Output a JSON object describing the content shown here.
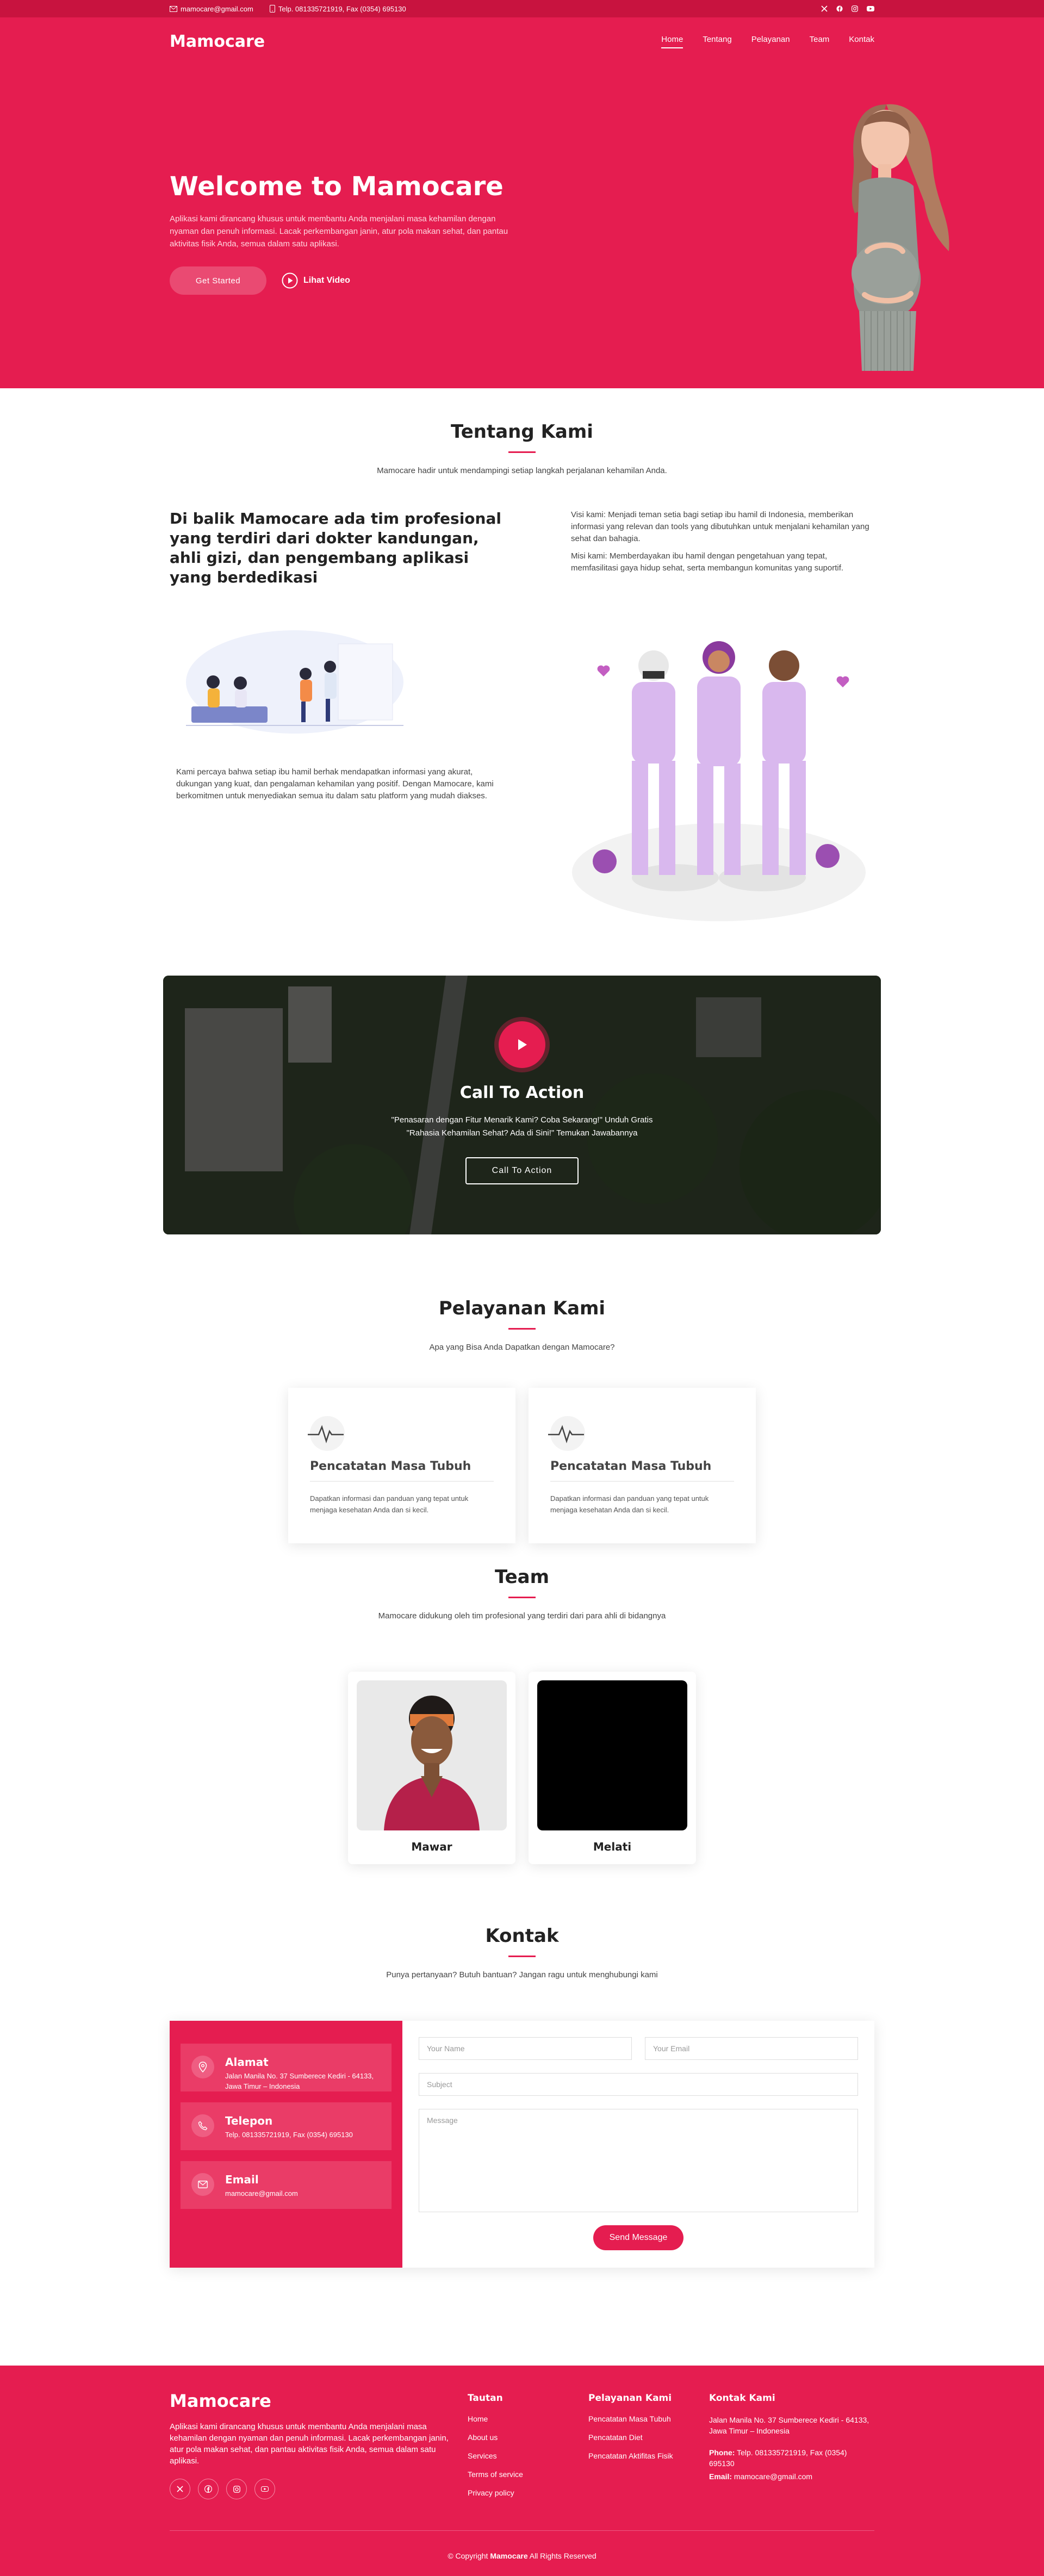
{
  "topbar": {
    "email": "mamocare@gmail.com",
    "phone": "Telp. 081335721919, Fax (0354) 695130",
    "social_icons": [
      "x-twitter-icon",
      "facebook-icon",
      "instagram-icon",
      "youtube-icon"
    ]
  },
  "header": {
    "logo": "Mamocare",
    "nav": [
      "Home",
      "Tentang",
      "Pelayanan",
      "Team",
      "Kontak"
    ],
    "active": "Home"
  },
  "hero": {
    "title": "Welcome to Mamocare",
    "description": "Aplikasi kami dirancang khusus untuk membantu Anda menjalani masa kehamilan dengan nyaman dan penuh informasi. Lacak perkembangan janin, atur pola makan sehat, dan pantau aktivitas fisik Anda, semua dalam satu aplikasi.",
    "cta_label": "Get Started",
    "video_label": "Lihat Video"
  },
  "about": {
    "title": "Tentang Kami",
    "subtitle": "Mamocare hadir untuk mendampingi setiap langkah perjalanan kehamilan Anda.",
    "heading": "Di balik Mamocare ada tim profesional yang terdiri dari dokter kandungan, ahli gizi, dan pengembang aplikasi yang berdedikasi",
    "vision": "Visi kami: Menjadi teman setia bagi setiap ibu hamil di Indonesia, memberikan informasi yang relevan dan tools yang dibutuhkan untuk menjalani kehamilan yang sehat dan bahagia.",
    "mission": "Misi kami: Memberdayakan ibu hamil dengan pengetahuan yang tepat, memfasilitasi gaya hidup sehat, serta membangun komunitas yang suportif.",
    "belief": "Kami percaya bahwa setiap ibu hamil berhak mendapatkan informasi yang akurat, dukungan yang kuat, dan pengalaman kehamilan yang positif. Dengan Mamocare, kami berkomitmen untuk menyediakan semua itu dalam satu platform yang mudah diakses."
  },
  "cta": {
    "title": "Call To Action",
    "line1": "\"Penasaran dengan Fitur Menarik Kami? Coba Sekarang!\" Unduh Gratis",
    "line2": "\"Rahasia Kehamilan Sehat? Ada di Sini!\" Temukan Jawabannya",
    "button": "Call To Action"
  },
  "services": {
    "title": "Pelayanan Kami",
    "subtitle": "Apa yang Bisa Anda Dapatkan dengan Mamocare?",
    "items": [
      {
        "title": "Pencatatan Masa Tubuh",
        "desc": "Dapatkan informasi dan panduan yang tepat untuk menjaga kesehatan Anda dan si kecil."
      },
      {
        "title": "Pencatatan Masa Tubuh",
        "desc": "Dapatkan informasi dan panduan yang tepat untuk menjaga kesehatan Anda dan si kecil."
      }
    ]
  },
  "team": {
    "title": "Team",
    "subtitle": "Mamocare didukung oleh tim profesional yang terdiri dari para ahli di bidangnya",
    "members": [
      {
        "name": "Mawar"
      },
      {
        "name": "Melati"
      }
    ]
  },
  "contact": {
    "title": "Kontak",
    "subtitle": "Punya pertanyaan? Butuh bantuan? Jangan ragu untuk menghubungi kami",
    "address_title": "Alamat",
    "address": "Jalan Manila No. 37 Sumberece Kediri - 64133, Jawa Timur – Indonesia",
    "phone_title": "Telepon",
    "phone": "Telp. 081335721919, Fax (0354) 695130",
    "email_title": "Email",
    "email": "mamocare@gmail.com",
    "form": {
      "name_placeholder": "Your Name",
      "email_placeholder": "Your Email",
      "subject_placeholder": "Subject",
      "message_placeholder": "Message",
      "send_label": "Send Message"
    }
  },
  "footer": {
    "logo": "Mamocare",
    "description": "Aplikasi kami dirancang khusus untuk membantu Anda menjalani masa kehamilan dengan nyaman dan penuh informasi. Lacak perkembangan janin, atur pola makan sehat, dan pantau aktivitas fisik Anda, semua dalam satu aplikasi.",
    "links_title": "Tautan",
    "links": [
      "Home",
      "About us",
      "Services",
      "Terms of service",
      "Privacy policy"
    ],
    "services_title": "Pelayanan Kami",
    "services": [
      "Pencatatan Masa Tubuh",
      "Pencatatan Diet",
      "Pencatatan Aktifitas Fisik"
    ],
    "contact_title": "Kontak Kami",
    "address": "Jalan Manila No. 37 Sumberece Kediri - 64133, Jawa Timur – Indonesia",
    "phone_label": "Phone:",
    "phone": "Telp. 081335721919, Fax (0354) 695130",
    "email_label": "Email:",
    "email": "mamocare@gmail.com",
    "copy_prefix": "© Copyright",
    "copy_brand": "Mamocare",
    "copy_suffix": "All Rights Reserved"
  },
  "colors": {
    "brand": "#e51d50",
    "brand_dark": "#c8133f"
  }
}
